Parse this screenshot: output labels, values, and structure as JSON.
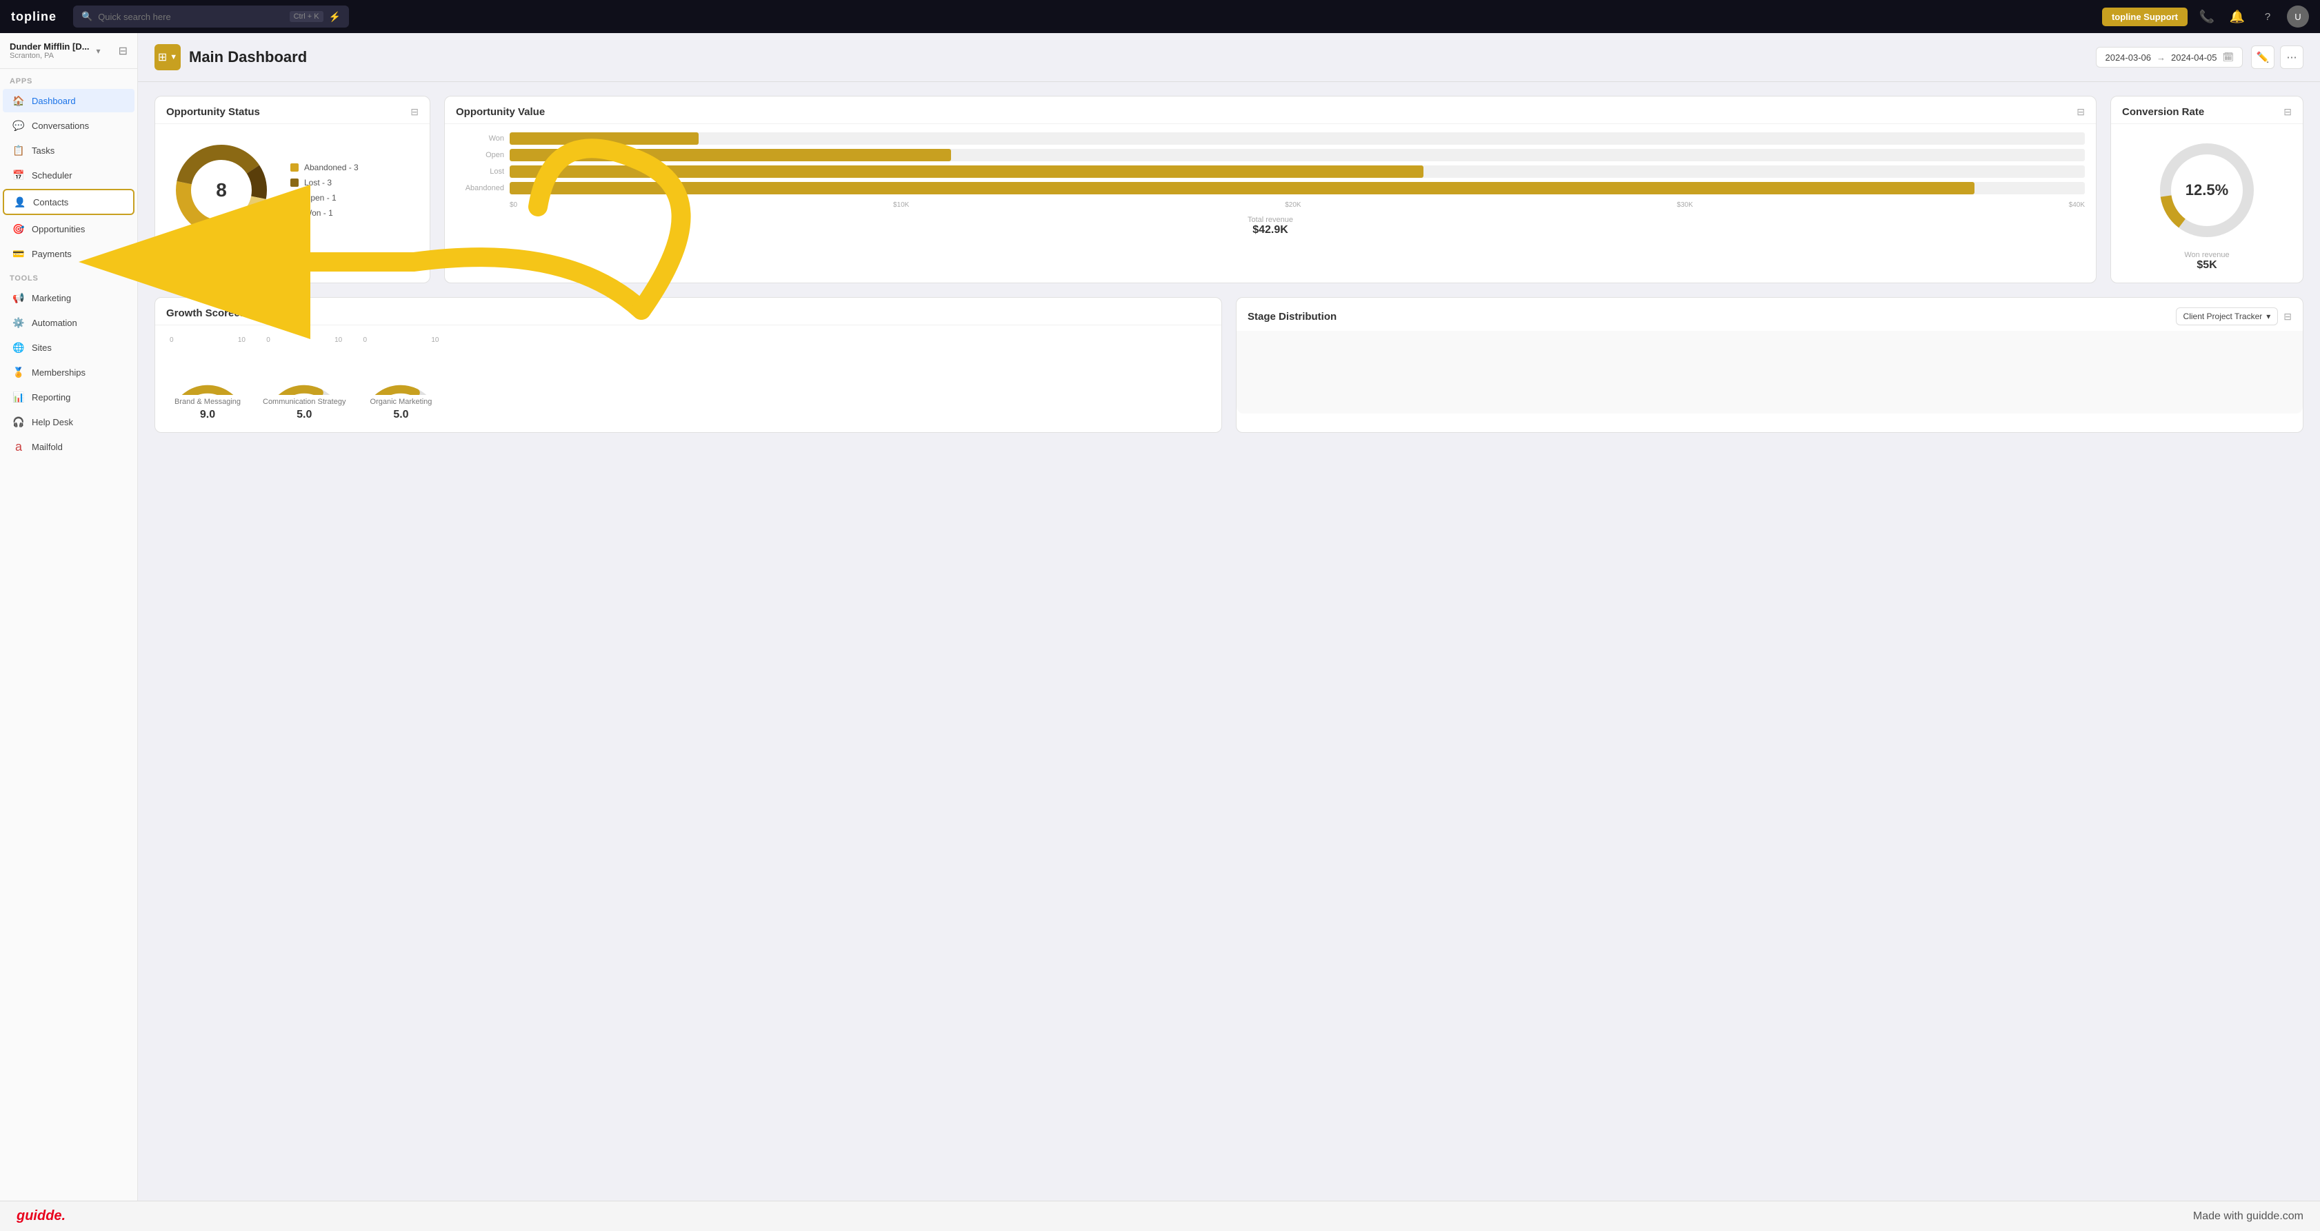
{
  "topnav": {
    "logo": "topline",
    "search_placeholder": "Quick search here",
    "search_shortcut": "Ctrl + K",
    "lightning_icon": "⚡",
    "support_btn": "topline Support",
    "phone_icon": "📞",
    "bell_icon": "🔔",
    "help_icon": "?",
    "avatar_label": "U"
  },
  "sidebar": {
    "workspace_name": "Dunder Mifflin [D...",
    "workspace_sub": "Scranton, PA",
    "apps_label": "Apps",
    "tools_label": "Tools",
    "items": [
      {
        "id": "dashboard",
        "label": "Dashboard",
        "icon": "🏠",
        "active": true
      },
      {
        "id": "conversations",
        "label": "Conversations",
        "icon": "💬",
        "active": false
      },
      {
        "id": "tasks",
        "label": "Tasks",
        "icon": "📋",
        "active": false
      },
      {
        "id": "scheduler",
        "label": "Scheduler",
        "icon": "📅",
        "active": false
      },
      {
        "id": "contacts",
        "label": "Contacts",
        "icon": "👤",
        "active": false,
        "highlighted": true
      },
      {
        "id": "opportunities",
        "label": "Opportunities",
        "icon": "🎯",
        "active": false
      },
      {
        "id": "payments",
        "label": "Payments",
        "icon": "💳",
        "active": false
      }
    ],
    "tool_items": [
      {
        "id": "marketing",
        "label": "Marketing",
        "icon": "📢"
      },
      {
        "id": "automation",
        "label": "Automation",
        "icon": "⚙️"
      },
      {
        "id": "sites",
        "label": "Sites",
        "icon": "🌐"
      },
      {
        "id": "memberships",
        "label": "Memberships",
        "icon": "🏅"
      },
      {
        "id": "reporting",
        "label": "Reporting",
        "icon": "📊"
      },
      {
        "id": "helpdesk",
        "label": "Help Desk",
        "icon": "🎧"
      },
      {
        "id": "mailfold",
        "label": "Mailfold",
        "icon": "✉️"
      }
    ]
  },
  "page_header": {
    "icon": "⊞",
    "chevron": "▼",
    "title": "Main Dashboard",
    "date_from": "2024-03-06",
    "date_to": "2024-04-05",
    "arrow": "→",
    "cal_icon": "🗓",
    "edit_icon": "✏️",
    "more_icon": "⋯"
  },
  "opportunity_status": {
    "title": "Opportunity Status",
    "total": "8",
    "legend": [
      {
        "label": "Abandoned - 3",
        "color": "#d4a520",
        "pct": 37.5
      },
      {
        "label": "Lost - 3",
        "color": "#b8901a",
        "pct": 37.5
      },
      {
        "label": "Open - 1",
        "color": "#7a5c0a",
        "pct": 12.5
      },
      {
        "label": "Won - 1",
        "color": "#e8cc70",
        "pct": 12.5
      }
    ]
  },
  "opportunity_value": {
    "title": "Opportunity Value",
    "bars": [
      {
        "label": "Won",
        "value": 5000,
        "max": 42900,
        "pct": 12
      },
      {
        "label": "Open",
        "value": 12000,
        "max": 42900,
        "pct": 28
      },
      {
        "label": "Lost",
        "value": 25000,
        "max": 42900,
        "pct": 58
      },
      {
        "label": "Abandoned",
        "value": 40000,
        "max": 42900,
        "pct": 93
      }
    ],
    "x_labels": [
      "$0",
      "$10K",
      "$20K",
      "$30K",
      "$40K"
    ],
    "total_revenue_label": "Total revenue",
    "total_revenue_value": "$42.9K"
  },
  "conversion_rate": {
    "title": "Conversion Rate",
    "value": "12.5%",
    "won_revenue_label": "Won revenue",
    "won_revenue_value": "$5K",
    "fill_pct": 12.5
  },
  "growth_scorecard": {
    "title": "Growth Scorecard",
    "items": [
      {
        "label": "Brand & Messaging",
        "value": "9.0",
        "pct": 90
      },
      {
        "label": "Communication Strategy",
        "value": "5.0",
        "pct": 50
      },
      {
        "label": "Organic Marketing",
        "value": "5.0",
        "pct": 50
      }
    ]
  },
  "stage_distribution": {
    "title": "Stage Distribution",
    "dropdown": "Client Project Tracker",
    "filter_icon": "⊟"
  },
  "guidde": {
    "logo": "guidde.",
    "made_with": "Made with guidde.com"
  }
}
